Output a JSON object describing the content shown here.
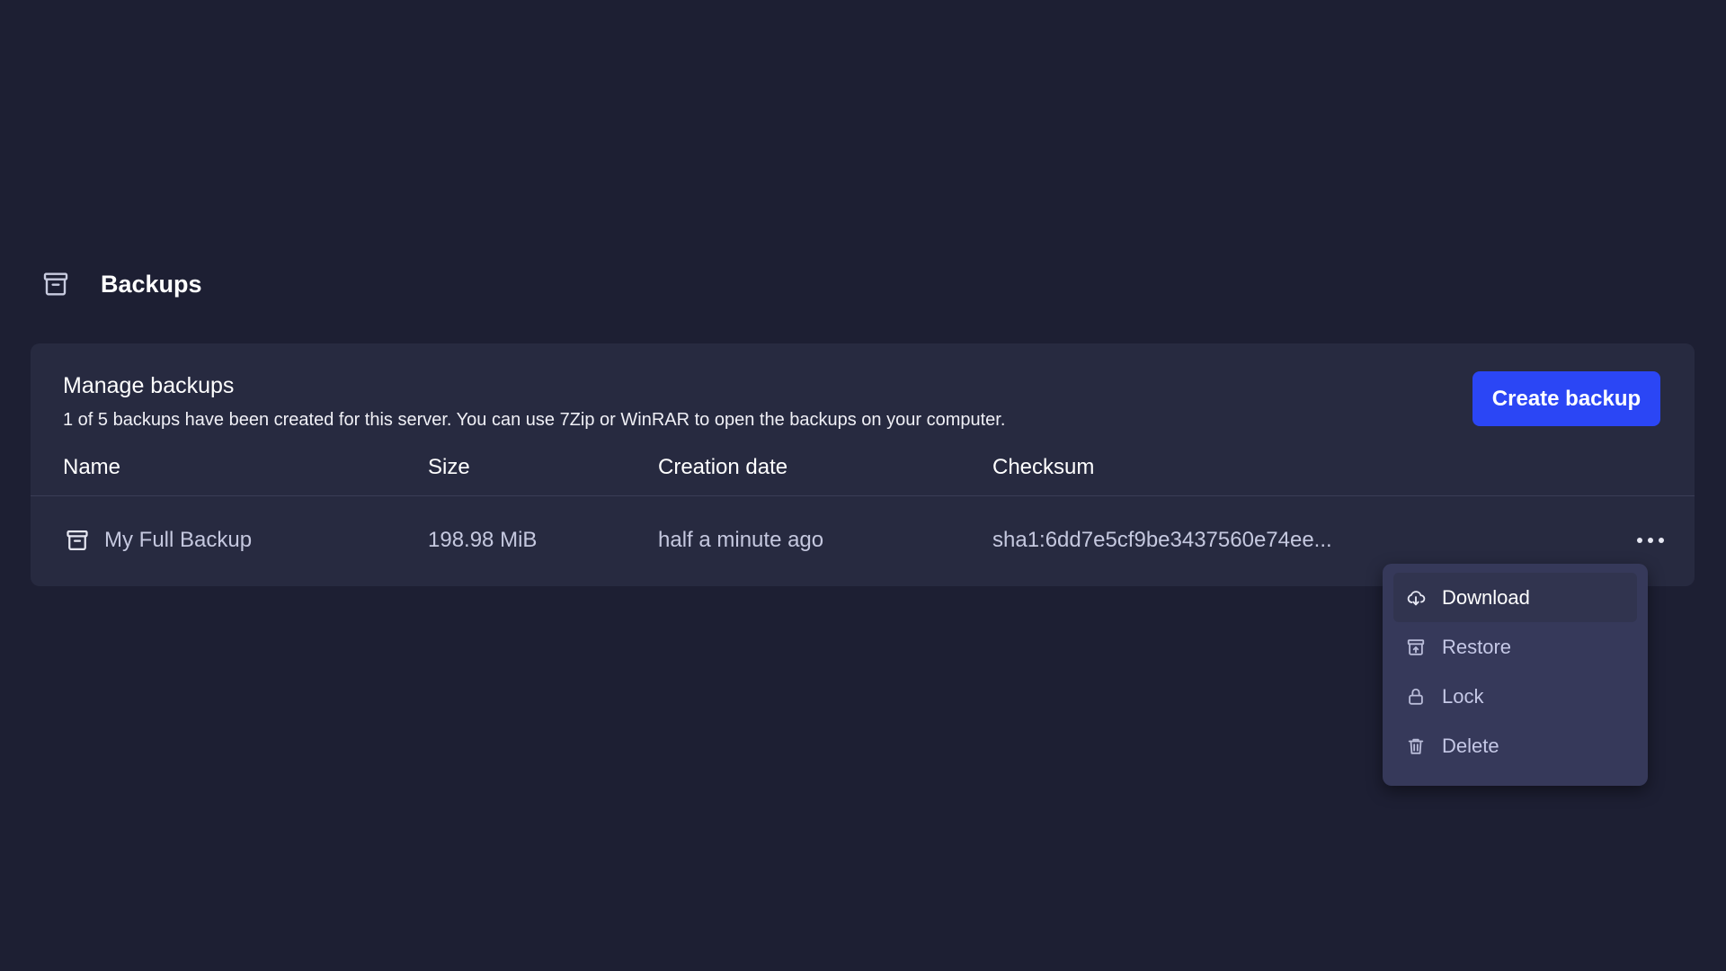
{
  "header": {
    "title": "Backups",
    "icon": "archive-icon"
  },
  "card": {
    "title": "Manage backups",
    "description": "1 of 5 backups have been created for this server. You can use 7Zip or WinRAR to open the backups on your computer.",
    "create_button": "Create backup"
  },
  "table": {
    "columns": [
      "Name",
      "Size",
      "Creation date",
      "Checksum"
    ],
    "rows": [
      {
        "name": "My Full Backup",
        "size": "198.98 MiB",
        "created": "half a minute ago",
        "checksum": "sha1:6dd7e5cf9be3437560e74ee...",
        "icon": "archive-icon"
      }
    ]
  },
  "menu": {
    "items": [
      {
        "label": "Download",
        "icon": "cloud-download-icon",
        "active": true
      },
      {
        "label": "Restore",
        "icon": "archive-restore-icon",
        "active": false
      },
      {
        "label": "Lock",
        "icon": "lock-icon",
        "active": false
      },
      {
        "label": "Delete",
        "icon": "trash-icon",
        "active": false
      }
    ]
  },
  "colors": {
    "background": "#1d1f33",
    "card": "#272a40",
    "accent": "#2b46f5",
    "menu": "#36395a"
  }
}
